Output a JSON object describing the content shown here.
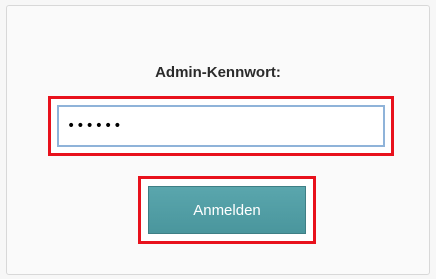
{
  "login": {
    "password_label": "Admin-Kennwort:",
    "password_value": "••••••",
    "submit_label": "Anmelden"
  },
  "colors": {
    "highlight": "#e8111c",
    "button_bg": "#4f9ca3",
    "input_border": "#8fb3d9"
  }
}
